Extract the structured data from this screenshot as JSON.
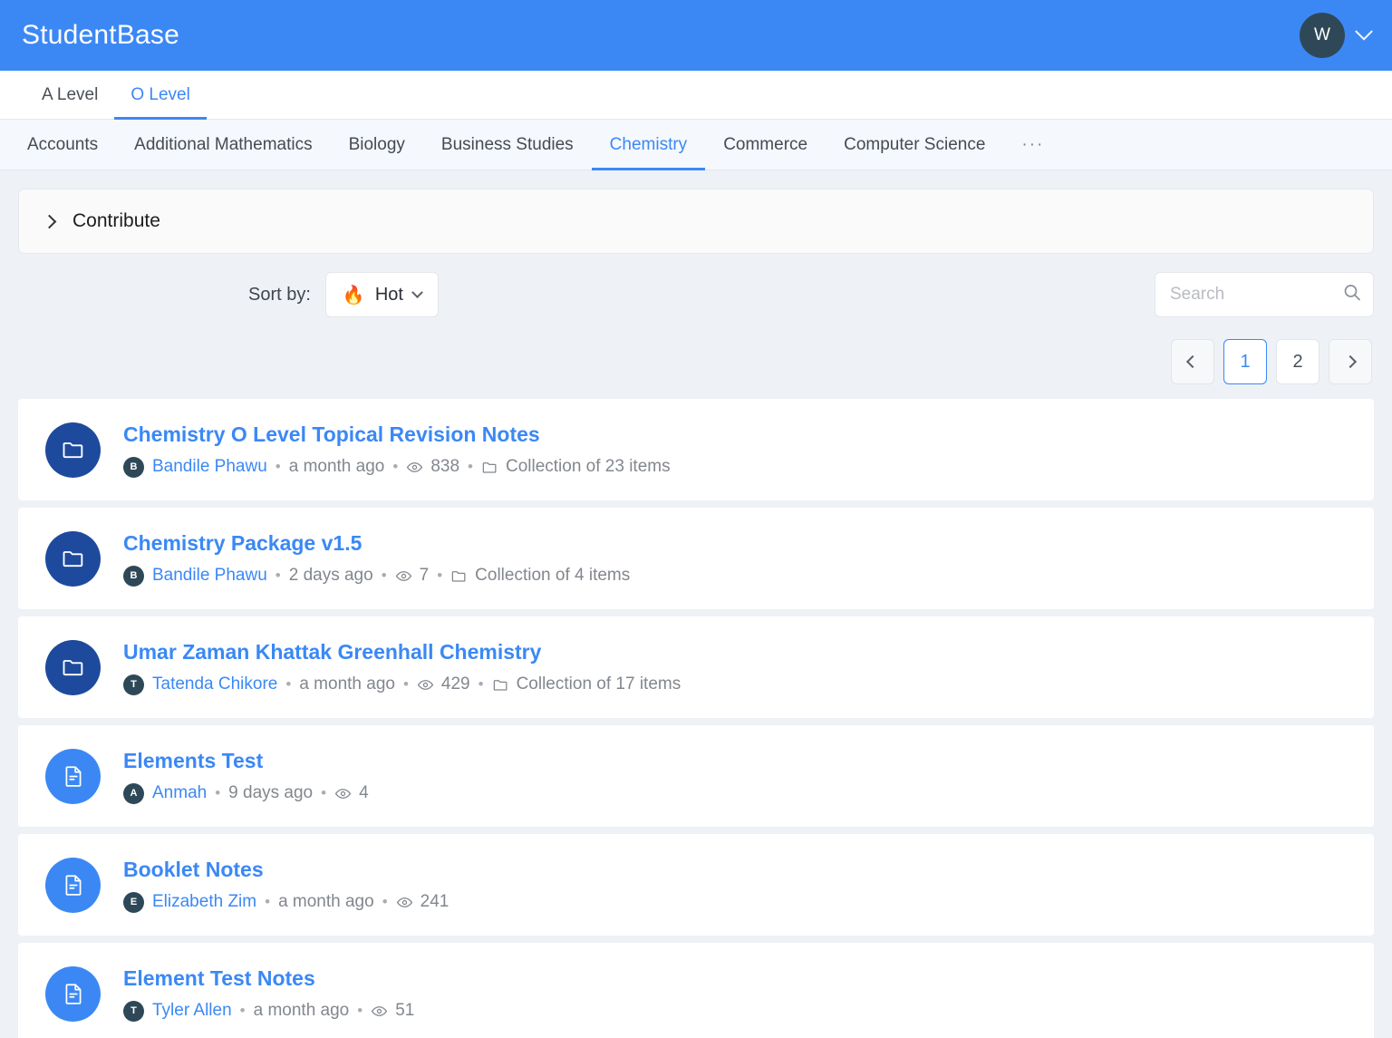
{
  "app": {
    "title": "StudentBase",
    "avatar_initial": "W",
    "header_color": "#3b88f5",
    "avatar_color": "#2f4858"
  },
  "level_tabs": [
    {
      "label": "A Level",
      "active": false
    },
    {
      "label": "O Level",
      "active": true
    }
  ],
  "subject_tabs": [
    {
      "label": "Accounts",
      "active": false
    },
    {
      "label": "Additional Mathematics",
      "active": false
    },
    {
      "label": "Biology",
      "active": false
    },
    {
      "label": "Business Studies",
      "active": false
    },
    {
      "label": "Chemistry",
      "active": true
    },
    {
      "label": "Commerce",
      "active": false
    },
    {
      "label": "Computer Science",
      "active": false
    }
  ],
  "subject_overflow": "···",
  "contribute": {
    "label": "Contribute",
    "icon": "chevron-right-icon"
  },
  "controls": {
    "sort_label": "Sort by:",
    "sort_value": "Hot",
    "sort_emoji": "🔥",
    "search_placeholder": "Search",
    "search_value": ""
  },
  "pagination": {
    "prev": "‹",
    "next": "›",
    "pages": [
      {
        "label": "1",
        "active": true
      },
      {
        "label": "2",
        "active": false
      }
    ]
  },
  "items": [
    {
      "title": "Chemistry O Level Topical Revision Notes",
      "type": "collection",
      "author": "Bandile Phawu",
      "author_initial": "B",
      "time": "a month ago",
      "views": "838",
      "collection": "Collection of 23 items"
    },
    {
      "title": "Chemistry Package v1.5",
      "type": "collection",
      "author": "Bandile Phawu",
      "author_initial": "B",
      "time": "2 days ago",
      "views": "7",
      "collection": "Collection of 4 items"
    },
    {
      "title": "Umar Zaman Khattak Greenhall Chemistry",
      "type": "collection",
      "author": "Tatenda Chikore",
      "author_initial": "T",
      "time": "a month ago",
      "views": "429",
      "collection": "Collection of 17 items"
    },
    {
      "title": "Elements Test",
      "type": "document",
      "author": "Anmah",
      "author_initial": "A",
      "time": "9 days ago",
      "views": "4",
      "collection": ""
    },
    {
      "title": "Booklet Notes",
      "type": "document",
      "author": "Elizabeth Zim",
      "author_initial": "E",
      "time": "a month ago",
      "views": "241",
      "collection": ""
    },
    {
      "title": "Element Test Notes",
      "type": "document",
      "author": "Tyler Allen",
      "author_initial": "T",
      "time": "a month ago",
      "views": "51",
      "collection": ""
    }
  ]
}
